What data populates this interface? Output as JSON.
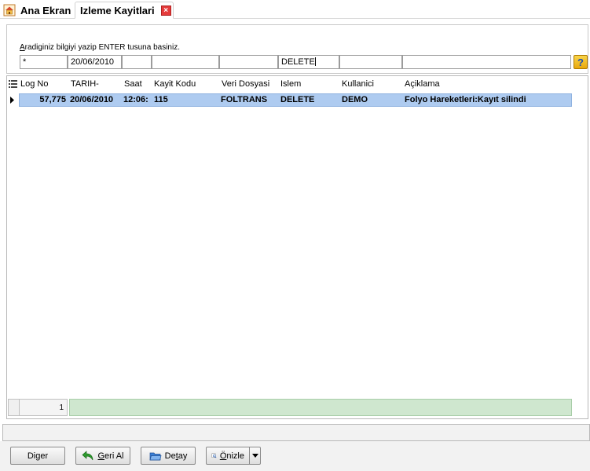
{
  "tabs": [
    {
      "label": "Ana Ekran",
      "icon": "home-icon"
    },
    {
      "label": "Izleme Kayitlari",
      "icon": "close-icon",
      "active": true
    }
  ],
  "filter": {
    "hint_prefix": "A",
    "hint_rest": "radiginiz bilgiyi yazip ENTER tusuna basiniz.",
    "fields": [
      "*",
      "20/06/2010",
      "",
      "",
      "",
      "DELETE",
      "",
      ""
    ]
  },
  "grid": {
    "columns": [
      "Log No",
      "TARIH-",
      "Saat",
      "Kayit Kodu",
      "Veri Dosyasi",
      "Islem",
      "Kullanici",
      "Açiklama"
    ],
    "rows": [
      [
        "57,775",
        "20/06/2010",
        "12:06:",
        "115",
        "FOLTRANS",
        "DELETE",
        "DEMO",
        "Folyo Hareketleri:Kayıt silindi"
      ]
    ],
    "record_count": "1"
  },
  "buttons": {
    "diger": {
      "pre": "Di",
      "ul": "g",
      "post": "er"
    },
    "geri_al": {
      "pre": "",
      "ul": "G",
      "post": "eri Al"
    },
    "detay": {
      "pre": "De",
      "ul": "t",
      "post": "ay"
    },
    "onizle": {
      "pre": "",
      "ul": "Ö",
      "post": "nizle"
    }
  },
  "colors": {
    "selected_row": "#aecbf0",
    "footer_green": "#cfe7cf",
    "close_red": "#e53b3b"
  }
}
